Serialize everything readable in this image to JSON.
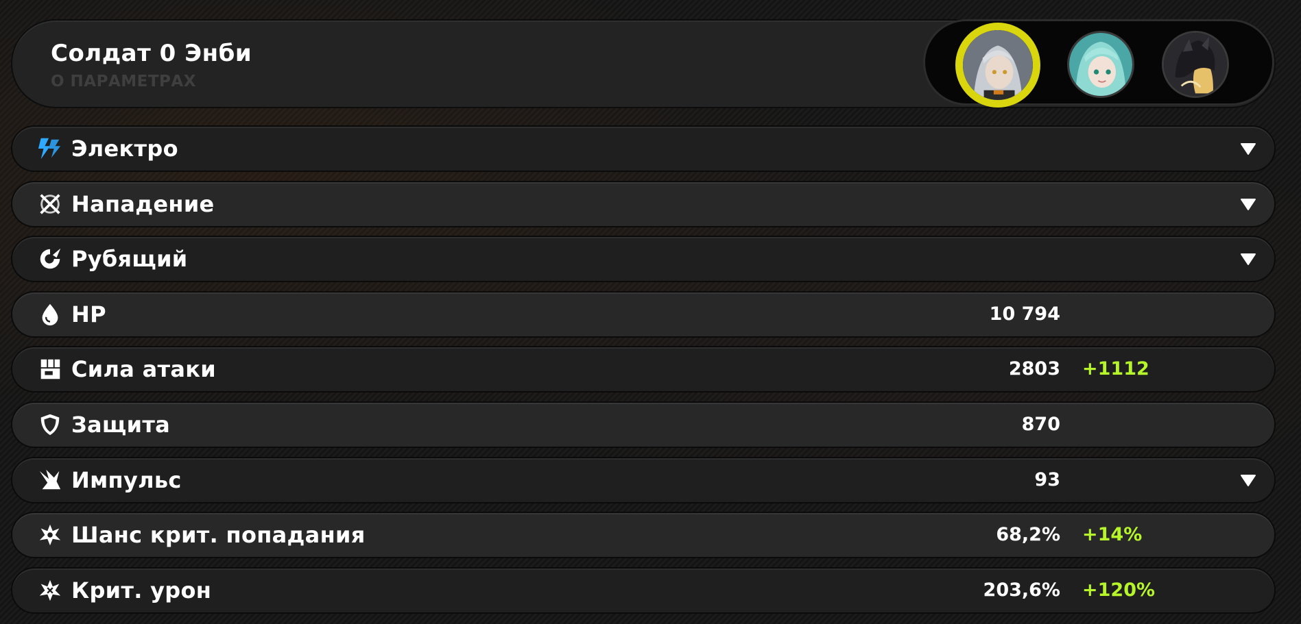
{
  "header": {
    "title": "Солдат 0 Энби",
    "subtitle": "О ПАРАМЕТРАХ"
  },
  "characters": [
    {
      "icon": "character-portrait-silver-hair",
      "active": true
    },
    {
      "icon": "character-portrait-teal-hair",
      "active": false
    },
    {
      "icon": "character-portrait-blonde-masked",
      "active": false
    }
  ],
  "stats": [
    {
      "label": "Электро",
      "icon": "electric-icon",
      "value": "",
      "bonus": "",
      "expandable": true
    },
    {
      "label": "Нападение",
      "icon": "attack-type-icon",
      "value": "",
      "bonus": "",
      "expandable": true
    },
    {
      "label": "Рубящий",
      "icon": "slash-icon",
      "value": "",
      "bonus": "",
      "expandable": true
    },
    {
      "label": "HP",
      "icon": "hp-drop-icon",
      "value": "10 794",
      "bonus": "",
      "expandable": false
    },
    {
      "label": "Сила атаки",
      "icon": "attack-fist-icon",
      "value": "2803",
      "bonus": "+1112",
      "expandable": false
    },
    {
      "label": "Защита",
      "icon": "shield-icon",
      "value": "870",
      "bonus": "",
      "expandable": false
    },
    {
      "label": "Импульс",
      "icon": "impact-icon",
      "value": "93",
      "bonus": "",
      "expandable": true
    },
    {
      "label": "Шанс крит. попадания",
      "icon": "crit-rate-icon",
      "value": "68,2%",
      "bonus": "+14%",
      "expandable": false
    },
    {
      "label": "Крит. урон",
      "icon": "crit-damage-icon",
      "value": "203,6%",
      "bonus": "+120%",
      "expandable": false
    }
  ],
  "colors": {
    "accent_ring": "#d9d60e",
    "bonus": "#b6f52a",
    "electric_icon": "#2fa8ff",
    "row_bg": "#1f1f1f"
  }
}
